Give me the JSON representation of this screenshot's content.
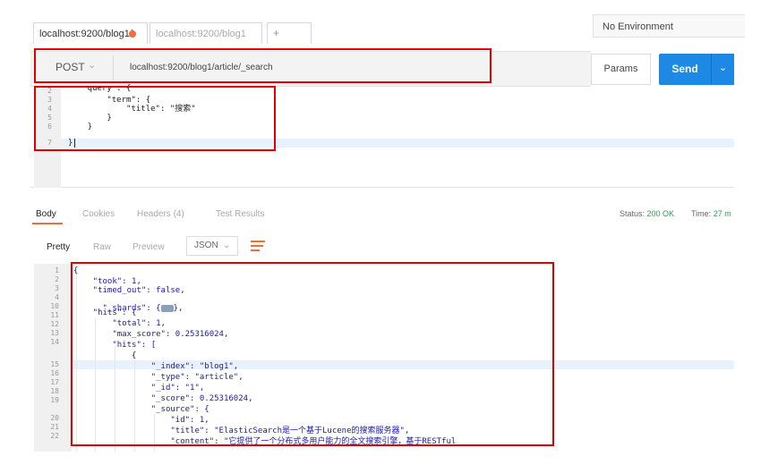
{
  "tabs": [
    {
      "label": "localhost:9200/blog1/",
      "modified": true
    },
    {
      "label": "localhost:9200/blog1",
      "modified": false
    }
  ],
  "tab_actions": "+ ···",
  "environment": "No Environment",
  "request": {
    "method": "POST",
    "url": "localhost:9200/blog1/article/_search",
    "params_label": "Params",
    "send_label": "Send"
  },
  "request_body": {
    "line_numbers": [
      "2",
      "3",
      "4",
      "5",
      "6",
      "7"
    ],
    "lines": [
      "    query : {",
      "        \"term\": {",
      "            \"title\": \"搜索\"",
      "        }",
      "    }",
      "}"
    ]
  },
  "response_tabs": {
    "body": "Body",
    "cookies": "Cookies",
    "headers": "Headers (4)",
    "test_results": "Test Results"
  },
  "status": {
    "status_label": "Status:",
    "status_value": "200 OK",
    "time_label": "Time:",
    "time_value": "27 m"
  },
  "toolbar": {
    "pretty": "Pretty",
    "raw": "Raw",
    "preview": "Preview",
    "format": "JSON"
  },
  "response_body": {
    "line_numbers": [
      "1",
      "2",
      "3",
      "4",
      "10",
      "11",
      "12",
      "13",
      "14",
      "15",
      "16",
      "17",
      "18",
      "19",
      "20",
      "21",
      "22"
    ],
    "lines": [
      "{",
      "    \"took\": 1,",
      "    \"timed_out\": false,",
      "    \"_shards\": {",
      "    \"hits\": {",
      "        \"total\": 1,",
      "        \"max_score\": 0.25316024,",
      "        \"hits\": [",
      "            {",
      "                \"_index\": \"blog1\",",
      "                \"_type\": \"article\",",
      "                \"_id\": \"1\",",
      "                \"_score\": 0.25316024,",
      "                \"_source\": {",
      "                    \"id\": 1,",
      "                    \"title\": \"ElasticSearch是一个基于Lucene的搜索服务器\",",
      "                    \"content\": \"它提供了一个分布式多用户能力的全文搜索引擎，基于RESTful"
    ],
    "shards_tail": "},"
  }
}
